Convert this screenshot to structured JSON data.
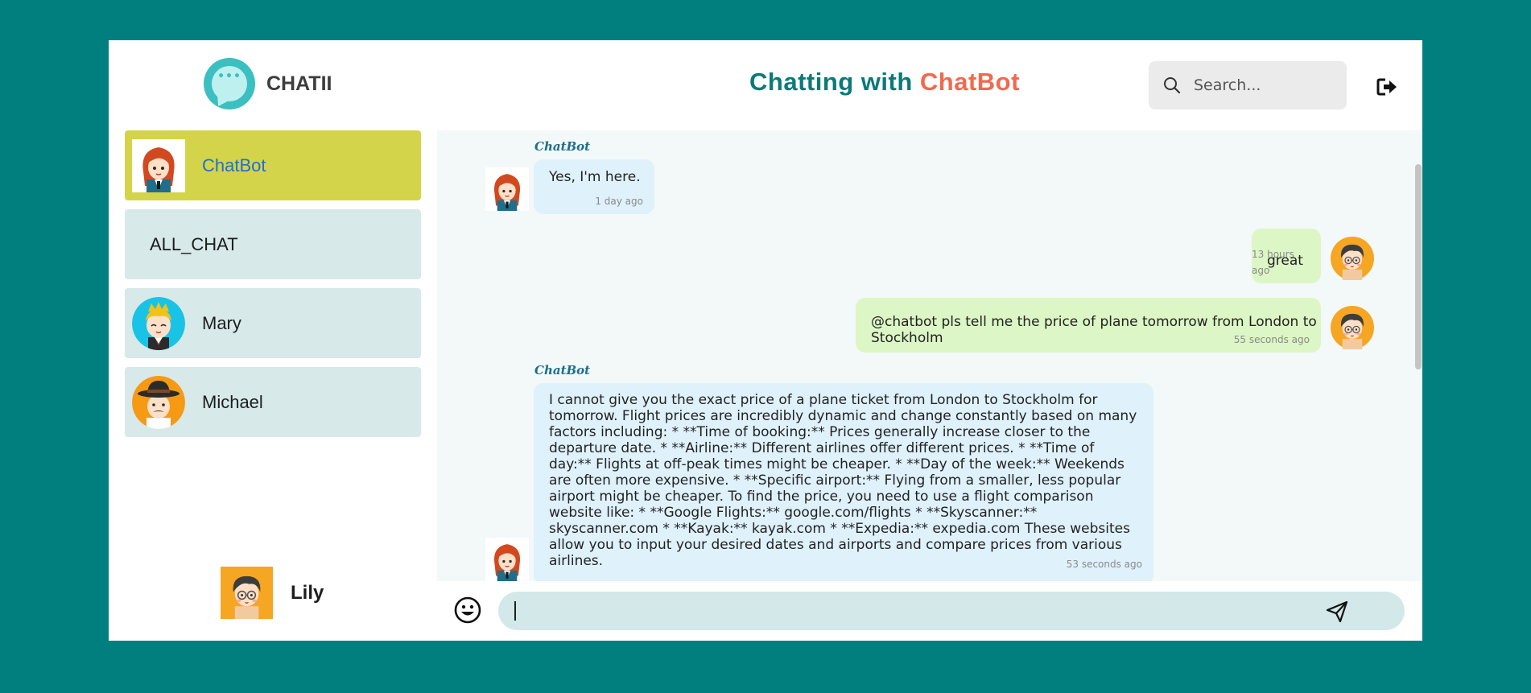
{
  "app": {
    "logo_text": "CHATII",
    "logo_dots": "•••"
  },
  "header": {
    "title_prefix": "Chatting with ",
    "title_name": "ChatBot",
    "search_placeholder": "Search..."
  },
  "sidebar": {
    "contacts": [
      {
        "label": "ChatBot",
        "active": true,
        "avatar": "girl-redhair-avatar"
      },
      {
        "label": "ALL_CHAT",
        "active": false,
        "avatar": ""
      },
      {
        "label": "Mary",
        "active": false,
        "avatar": "boy-crown-avatar"
      },
      {
        "label": "Michael",
        "active": false,
        "avatar": "man-hat-avatar"
      }
    ],
    "current_user": {
      "label": "Lily",
      "avatar": "boy-glasses-avatar"
    }
  },
  "messages": [
    {
      "sender": "ChatBot",
      "from": "bot",
      "text": "Yes, I'm here.",
      "time": "1 day ago"
    },
    {
      "sender": "",
      "from": "me",
      "text": "great",
      "time": "13 hours ago"
    },
    {
      "sender": "",
      "from": "me",
      "text": "@chatbot pls tell me the price of plane tomorrow from London to Stockholm",
      "time": "55 seconds ago"
    },
    {
      "sender": "ChatBot",
      "from": "bot",
      "text": "I cannot give you the exact price of a plane ticket from London to Stockholm for tomorrow. Flight prices are incredibly dynamic and change constantly based on many factors including: * **Time of booking:** Prices generally increase closer to the departure date. * **Airline:** Different airlines offer different prices. * **Time of day:** Flights at off-peak times might be cheaper. * **Day of the week:** Weekends are often more expensive. * **Specific airport:** Flying from a smaller, less popular airport might be cheaper. To find the price, you need to use a flight comparison website like: * **Google Flights:** google.com/flights * **Skyscanner:** skyscanner.com * **Kayak:** kayak.com * **Expedia:** expedia.com These websites allow you to input your desired dates and airports and compare prices from various airlines.",
      "time": "53 seconds ago"
    }
  ],
  "composer": {
    "value": "",
    "placeholder": ""
  },
  "icons": {
    "search": "search-icon",
    "logout": "logout-icon",
    "emoji": "smiley-icon",
    "send": "send-icon"
  },
  "colors": {
    "background": "#017f7f",
    "title_primary": "#0b7a78",
    "title_accent": "#f06a4f",
    "active_contact": "#d4d44a",
    "contact_bg": "#d7e9e9",
    "bot_bubble": "#dff1fb",
    "user_bubble": "#dcf6c5"
  }
}
